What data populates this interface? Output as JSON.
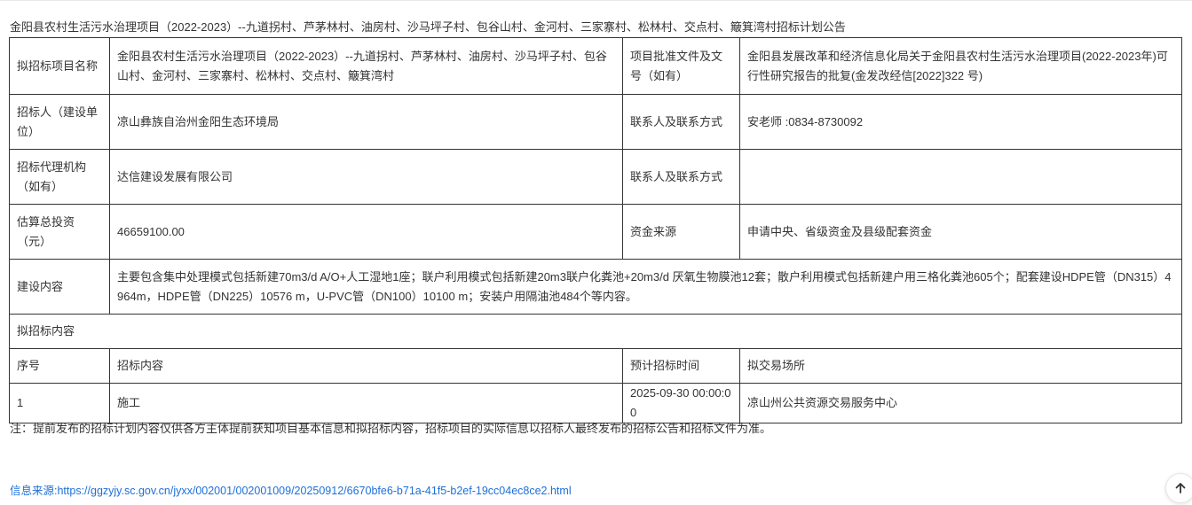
{
  "page": {
    "title": "金阳县农村生活污水治理项目（2022-2023）--九道拐村、芦茅林村、油房村、沙马坪子村、包谷山村、金河村、三家寨村、松林村、交点村、簸箕湾村招标计划公告"
  },
  "table": {
    "rows": [
      {
        "label1": "拟招标项目名称",
        "value1": "金阳县农村生活污水治理项目（2022-2023）--九道拐村、芦茅林村、油房村、沙马坪子村、包谷山村、金河村、三家寨村、松林村、交点村、簸箕湾村",
        "label2": "项目批准文件及文号（如有）",
        "value2": "金阳县发展改革和经济信息化局关于金阳县农村生活污水治理项目(2022-2023年)可行性研究报告的批复(金发改经信[2022]322 号)"
      },
      {
        "label1": "招标人（建设单位）",
        "value1": "凉山彝族自治州金阳生态环境局",
        "label2": "联系人及联系方式",
        "value2": "安老师 :0834-8730092"
      },
      {
        "label1": "招标代理机构（如有）",
        "value1": "达信建设发展有限公司",
        "label2": "联系人及联系方式",
        "value2": ""
      },
      {
        "label1": "估算总投资（元）",
        "value1": "46659100.00",
        "label2": "资金来源",
        "value2": "申请中央、省级资金及县级配套资金"
      }
    ],
    "construction": {
      "label": "建设内容",
      "value": "主要包含集中处理模式包括新建70m3/d A/O+人工湿地1座；联户利用模式包括新建20m3联户化粪池+20m3/d 厌氧生物膜池12套；散户利用模式包括新建户用三格化粪池605个；配套建设HDPE管（DN315）4964m，HDPE管（DN225）10576 m，U-PVC管（DN100）10100 m；安装户用隔油池484个等内容。"
    },
    "section_label": "拟招标内容",
    "headers": [
      "序号",
      "招标内容",
      "预计招标时间",
      "拟交易场所"
    ],
    "items": [
      {
        "no": "1",
        "content": "施工",
        "time": "2025-09-30 00:00:00",
        "place": "凉山州公共资源交易服务中心"
      }
    ]
  },
  "footnote": "注：提前发布的招标计划内容仅供各方主体提前获知项目基本信息和拟招标内容，招标项目的实际信息以招标人最终发布的招标公告和招标文件为准。",
  "source": {
    "label": "信息来源:",
    "url": "https://ggzyjy.sc.gov.cn/jyxx/002001/002001009/20250912/6670bfe6-b71a-41f5-b2ef-19cc04ec8ce2.html"
  },
  "back_to_top": {
    "icon": "arrow-up-icon"
  },
  "colors": {
    "link": "#1e6fd9",
    "agency": "#e60000",
    "border": "#333333",
    "text": "#333333"
  }
}
